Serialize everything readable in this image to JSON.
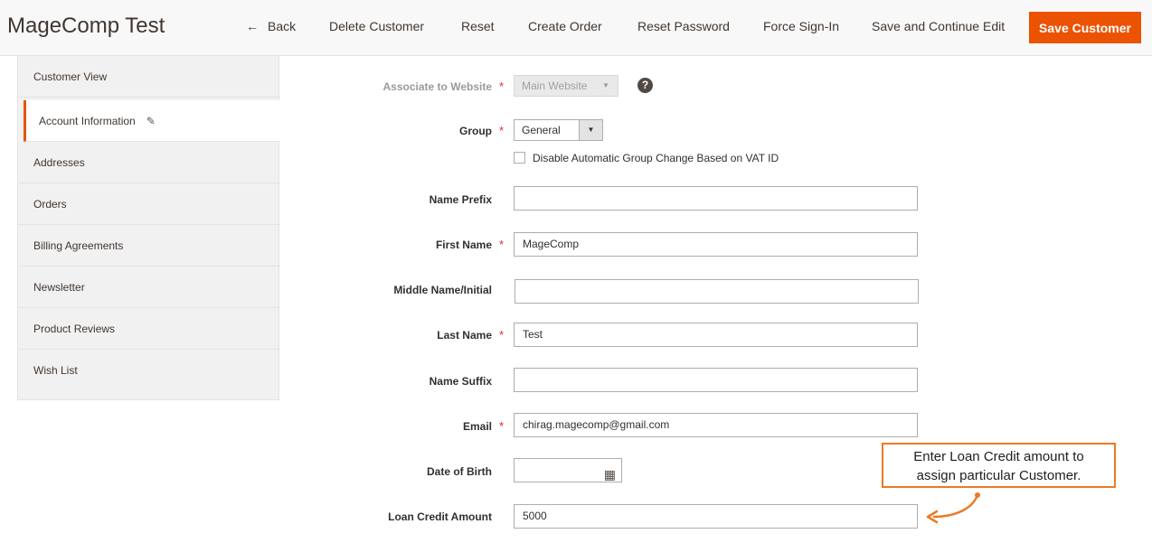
{
  "header": {
    "title": "MageComp Test",
    "actions": {
      "back": "Back",
      "delete": "Delete Customer",
      "reset": "Reset",
      "create_order": "Create Order",
      "reset_password": "Reset Password",
      "force_signin": "Force Sign-In",
      "save_continue": "Save and Continue Edit",
      "save": "Save Customer"
    }
  },
  "sidebar": {
    "items": [
      {
        "label": "Customer View"
      },
      {
        "label": "Account Information"
      },
      {
        "label": "Addresses"
      },
      {
        "label": "Orders"
      },
      {
        "label": "Billing Agreements"
      },
      {
        "label": "Newsletter"
      },
      {
        "label": "Product Reviews"
      },
      {
        "label": "Wish List"
      }
    ],
    "active_index": 1
  },
  "form": {
    "website": {
      "label": "Associate to Website",
      "value": "Main Website"
    },
    "group": {
      "label": "Group",
      "value": "General"
    },
    "disable_group_change": {
      "label": "Disable Automatic Group Change Based on VAT ID",
      "checked": false
    },
    "prefix": {
      "label": "Name Prefix",
      "value": ""
    },
    "first_name": {
      "label": "First Name",
      "value": "MageComp"
    },
    "middle_name": {
      "label": "Middle Name/Initial",
      "value": ""
    },
    "last_name": {
      "label": "Last Name",
      "value": "Test"
    },
    "suffix": {
      "label": "Name Suffix",
      "value": ""
    },
    "email": {
      "label": "Email",
      "value": "chirag.magecomp@gmail.com"
    },
    "dob": {
      "label": "Date of Birth",
      "value": ""
    },
    "loan_credit": {
      "label": "Loan Credit Amount",
      "value": "5000"
    }
  },
  "callout": {
    "line1": "Enter Loan Credit amount to",
    "line2": "assign particular Customer."
  },
  "colors": {
    "accent": "#eb5202",
    "callout_border": "#eb7a23",
    "required": "#e22626"
  }
}
